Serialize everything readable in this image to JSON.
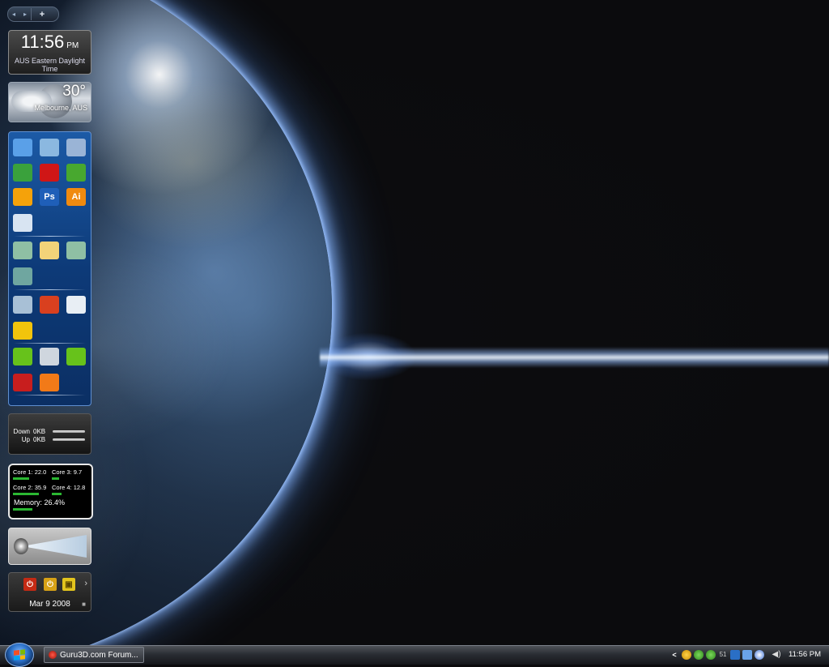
{
  "desktop": {
    "sidebar_nav": {
      "prev": "◂",
      "next": "▸",
      "add": "+"
    },
    "clock": {
      "time": "11:56",
      "ampm": "PM",
      "timezone": "AUS Eastern Daylight Time"
    },
    "weather": {
      "temperature": "30°",
      "location": "Melbourne, AUS"
    },
    "launcher": {
      "rows": [
        [
          {
            "icon": "monitor-icon",
            "color": "#5aa0e8"
          },
          {
            "icon": "computer-icon",
            "color": "#8bb8e0"
          },
          {
            "icon": "network-icon",
            "color": "#9ab4d6"
          }
        ],
        [
          {
            "icon": "messenger-icon",
            "color": "#3aa13c"
          },
          {
            "icon": "opera-icon",
            "color": "#d01616"
          },
          {
            "icon": "utorrent-icon",
            "color": "#48a82f"
          }
        ],
        [
          {
            "icon": "winamp-icon",
            "color": "#f5a20a"
          },
          {
            "icon": "photoshop-icon",
            "label": "Ps",
            "color": "#1f5fb8"
          },
          {
            "icon": "illustrator-icon",
            "label": "Ai",
            "color": "#f08a0f"
          }
        ],
        [
          {
            "icon": "mail-icon",
            "color": "#d8e4f2"
          }
        ],
        [
          {
            "icon": "library-icon",
            "color": "#8fbfa4"
          },
          {
            "icon": "folder-icon",
            "color": "#f2d379"
          },
          {
            "icon": "pictures-icon",
            "color": "#8fbfa4"
          }
        ],
        [
          {
            "icon": "documents-icon",
            "color": "#6fa6a0"
          }
        ],
        [
          {
            "icon": "gears-icon",
            "color": "#a8c0d6"
          },
          {
            "icon": "ccleaner-icon",
            "color": "#d9401f"
          },
          {
            "icon": "drive-icon",
            "color": "#e8eef4"
          }
        ],
        [
          {
            "icon": "pulse-icon",
            "color": "#f2c40c"
          }
        ],
        [
          {
            "icon": "nvidia-icon",
            "color": "#67c21b"
          },
          {
            "icon": "robot-icon",
            "color": "#cfd6de"
          },
          {
            "icon": "nvidia-alt-icon",
            "color": "#67c21b"
          }
        ],
        [
          {
            "icon": "spider-icon",
            "color": "#c81e1e"
          },
          {
            "icon": "flower-icon",
            "color": "#f27a18"
          }
        ]
      ]
    },
    "network": {
      "down_label": "Down",
      "down_value": "0KB",
      "up_label": "Up",
      "up_value": "0KB"
    },
    "cpu": {
      "cores": [
        {
          "label": "Core 1:",
          "value": "22.0",
          "percent": 22
        },
        {
          "label": "Core 3:",
          "value": "9.7",
          "percent": 10
        },
        {
          "label": "Core 2:",
          "value": "35.9",
          "percent": 36
        },
        {
          "label": "Core 4:",
          "value": "12.8",
          "percent": 13
        }
      ],
      "memory_label": "Memory:",
      "memory_value": "26.4%",
      "memory_percent": 26.4
    },
    "power": {
      "date": "Mar 9 2008",
      "shutdown": "⏻",
      "sleep": "⏻",
      "lock": "▣"
    }
  },
  "taskbar": {
    "task_label": "Guru3D.com Forum...",
    "tray_arrow": "<",
    "tray_clock": "11:56 PM"
  }
}
